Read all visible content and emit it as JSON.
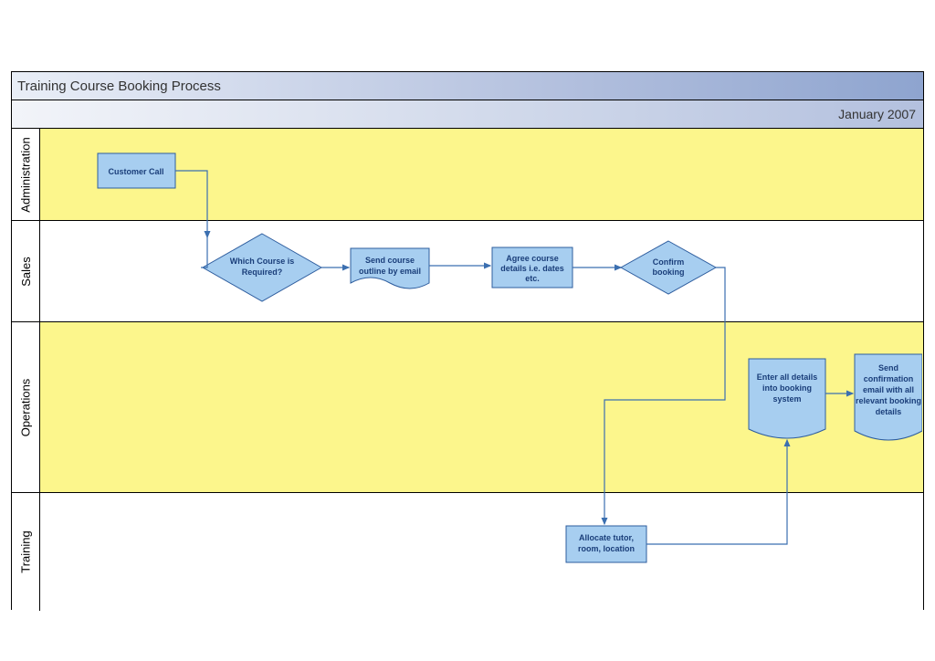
{
  "title": "Training Course Booking Process",
  "date": "January 2007",
  "lanes": {
    "l1": "Administration",
    "l2": "Sales",
    "l3": "Operations",
    "l4": "Training"
  },
  "nodes": {
    "customer_call": "Customer Call",
    "which_course_l1": "Which Course is",
    "which_course_l2": "Required?",
    "send_outline_l1": "Send course",
    "send_outline_l2": "outline by email",
    "agree_l1": "Agree course",
    "agree_l2": "details i.e. dates",
    "agree_l3": "etc.",
    "confirm_l1": "Confirm",
    "confirm_l2": "booking",
    "allocate_l1": "Allocate tutor,",
    "allocate_l2": "room, location",
    "enter_l1": "Enter all details",
    "enter_l2": "into booking",
    "enter_l3": "system",
    "sendconf_l1": "Send",
    "sendconf_l2": "confirmation",
    "sendconf_l3": "email with all",
    "sendconf_l4": "relevant booking",
    "sendconf_l5": "details"
  }
}
